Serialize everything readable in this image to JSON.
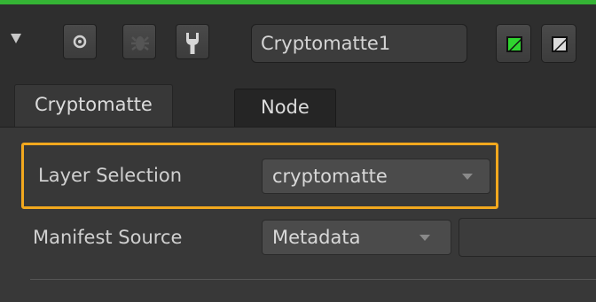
{
  "node": {
    "name": "Cryptomatte1"
  },
  "toolbar": {
    "icons": [
      "collapse-triangle-icon",
      "target-circle-icon",
      "bug-icon",
      "wrench-icon",
      "green-swatch-icon",
      "white-swatch-icon"
    ],
    "accent_color": "#35b435"
  },
  "tabs": [
    {
      "label": "Cryptomatte",
      "active": true
    },
    {
      "label": "Node",
      "active": false
    }
  ],
  "knobs": {
    "layer_selection": {
      "label": "Layer Selection",
      "value": "cryptomatte",
      "highlight_color": "#f2a81e"
    },
    "manifest_source": {
      "label": "Manifest Source",
      "value": "Metadata"
    }
  }
}
